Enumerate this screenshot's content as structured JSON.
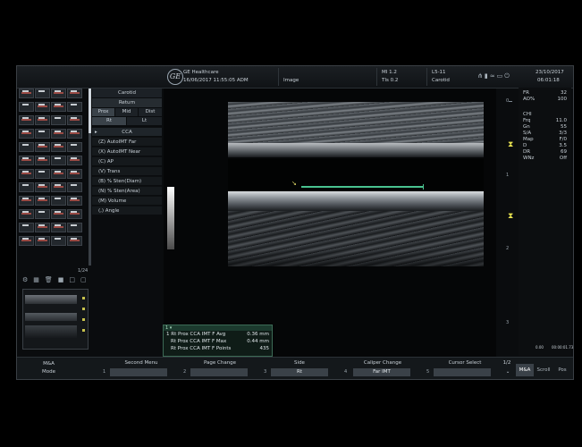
{
  "header": {
    "brand": "GE Healthcare",
    "datetime": "16/06/2017 11:55:05 ADM",
    "image_label": "Image",
    "mi": "MI 1.2",
    "tis": "TIs 0.2",
    "probe": "L5-11",
    "preset": "Carotid",
    "date": "23/10/2017",
    "time": "06:01:18"
  },
  "menu": {
    "title": "Carotid",
    "return_label": "Return",
    "segments": [
      "Prox",
      "Mid",
      "Dist"
    ],
    "sides": [
      "Rt",
      "Lt"
    ],
    "vessel": "CCA",
    "items": [
      "(Z) AutoIMT Far",
      "(X) AutoIMT Near",
      "(C) AP",
      "(V) Trans",
      "(B) % Sten(Diam)",
      "(N) % Sten(Area)",
      "(M) Volume",
      "(,) Angle"
    ]
  },
  "thumbnails": {
    "count": "1/24"
  },
  "results": {
    "title": "1 ▾",
    "rows": [
      {
        "label": "1  Rt Prox  CCA IMT F Avg",
        "value": "0.36 mm"
      },
      {
        "label": "Rt Prox  CCA IMT F Max",
        "value": "0.44 mm"
      },
      {
        "label": "Rt Prox  CCA IMT F Points",
        "value": "435"
      }
    ]
  },
  "params": {
    "top": [
      {
        "label": "FR",
        "value": "32"
      },
      {
        "label": "AO%",
        "value": "100"
      }
    ],
    "section": "CHI",
    "list": [
      {
        "label": "Frq",
        "value": "11.0"
      },
      {
        "label": "Gn",
        "value": "55"
      },
      {
        "label": "S/A",
        "value": "3/3"
      },
      {
        "label": "Map",
        "value": "F/0"
      },
      {
        "label": "D",
        "value": "3.5"
      },
      {
        "label": "DR",
        "value": "69"
      },
      {
        "label": "WNz",
        "value": "Off"
      }
    ],
    "footer_left": "0.00",
    "footer_right": "00:00:01.73"
  },
  "depth_marks": [
    "0",
    "1",
    "2",
    "3"
  ],
  "softkeys": {
    "mode_top": "M&A",
    "mode_bottom": "Mode",
    "keys": [
      {
        "num": "1",
        "label": "Second Menu",
        "value": ""
      },
      {
        "num": "2",
        "label": "Page Change",
        "value": ""
      },
      {
        "num": "3",
        "label": "Side",
        "value": "Rt"
      },
      {
        "num": "4",
        "label": "Caliper Change",
        "value": "Far IMT"
      },
      {
        "num": "5",
        "label": "Cursor Select",
        "value": ""
      }
    ],
    "page": "1/2",
    "tabs": [
      "M&A",
      "Scroll",
      "Pos"
    ]
  },
  "colors": {
    "imt_trace": "#49c28f",
    "focus_marker": "#e4df4f",
    "results_border": "#3c6a55"
  }
}
